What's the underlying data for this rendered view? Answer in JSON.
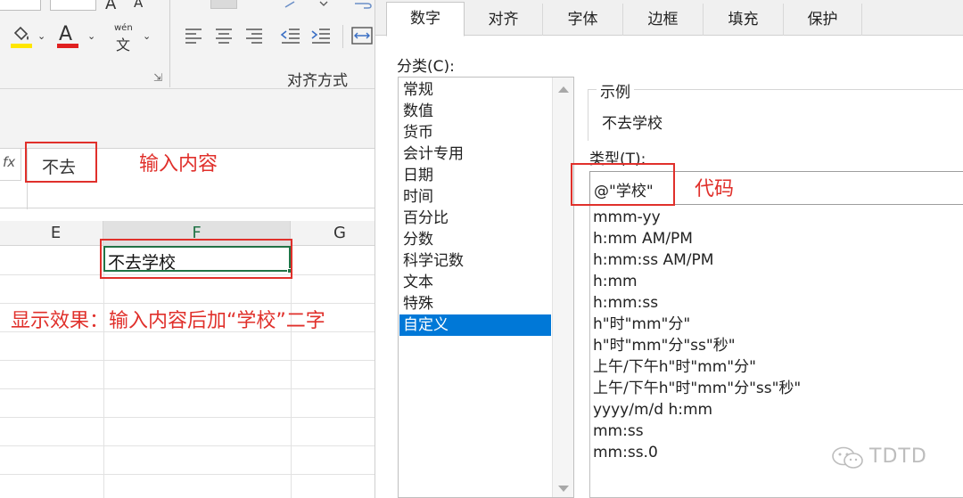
{
  "ribbon": {
    "font_color_letter": "A",
    "phonetic_top": "wén",
    "phonetic_bottom": "文",
    "alignment_group_label": "对齐方式",
    "grow_font": "A",
    "shrink_font": "A"
  },
  "formula_bar": {
    "fx_symbol": "fx",
    "content": "不去"
  },
  "sheet": {
    "columns": [
      "E",
      "F",
      "G"
    ],
    "active_cell_value": "不去学校"
  },
  "annotations": {
    "input_content": "输入内容",
    "display_effect": "显示效果：输入内容后加“学校”二字",
    "code": "代码"
  },
  "dialog": {
    "tabs": [
      "数字",
      "对齐",
      "字体",
      "边框",
      "填充",
      "保护"
    ],
    "active_tab": "数字",
    "category_label": "分类(C):",
    "categories": [
      "常规",
      "数值",
      "货币",
      "会计专用",
      "日期",
      "时间",
      "百分比",
      "分数",
      "科学记数",
      "文本",
      "特殊",
      "自定义"
    ],
    "selected_category": "自定义",
    "sample_label": "示例",
    "sample_value": "不去学校",
    "type_label": "类型(T):",
    "type_value": "@\"学校\"",
    "type_list": [
      "mmm-yy",
      "h:mm AM/PM",
      "h:mm:ss AM/PM",
      "h:mm",
      "h:mm:ss",
      "h\"时\"mm\"分\"",
      "h\"时\"mm\"分\"ss\"秒\"",
      "上午/下午h\"时\"mm\"分\"",
      "上午/下午h\"时\"mm\"分\"ss\"秒\"",
      "yyyy/m/d h:mm",
      "mm:ss",
      "mm:ss.0"
    ]
  },
  "watermark": {
    "text": "TDTD",
    "icon": "wechat-icon"
  },
  "colors": {
    "annotation_red": "#e0302b",
    "selection_blue": "#0078d7",
    "cell_border_green": "#217346",
    "font_color_red": "#e02020",
    "highlight_yellow": "#ffe600"
  }
}
